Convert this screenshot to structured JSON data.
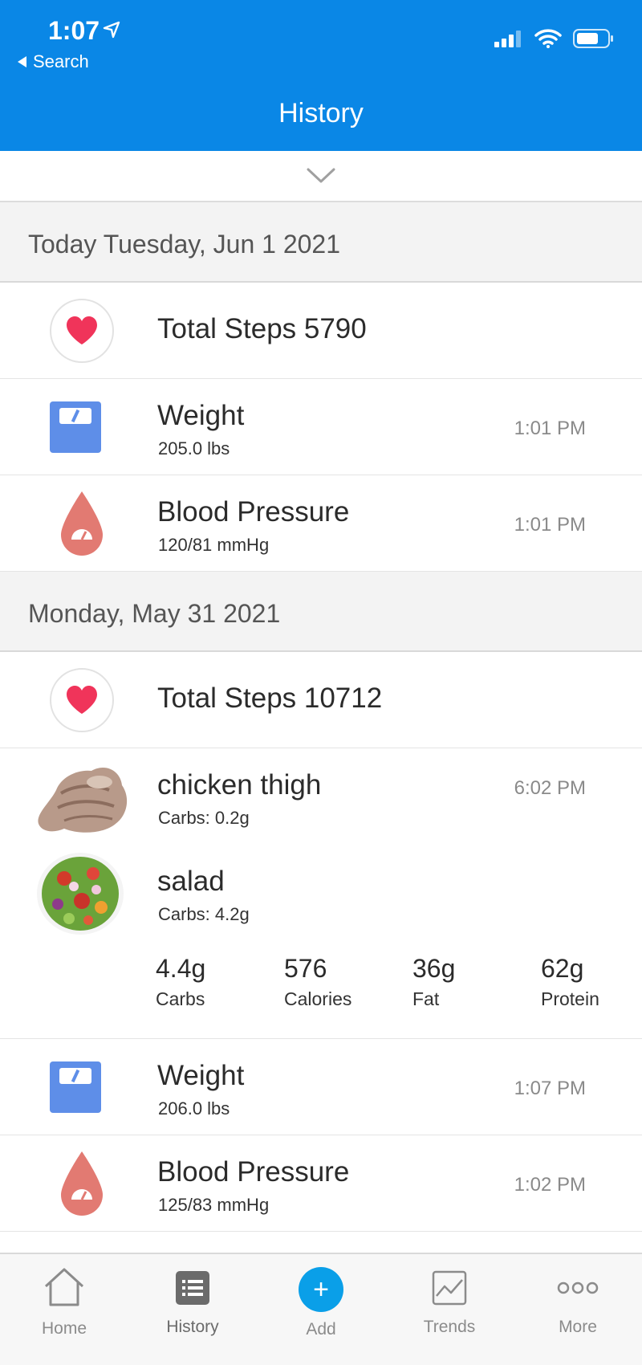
{
  "status_bar": {
    "time": "1:07",
    "back_label": "Search"
  },
  "header": {
    "title": "History"
  },
  "days": [
    {
      "date": "Today Tuesday, Jun 1 2021",
      "steps": "Total Steps 5790",
      "weight": {
        "label": "Weight",
        "value": "205.0 lbs",
        "time": "1:01 PM"
      },
      "bp": {
        "label": "Blood Pressure",
        "value": "120/81 mmHg",
        "time": "1:01 PM"
      }
    },
    {
      "date": "Monday, May 31 2021",
      "steps": "Total Steps 10712",
      "meal": {
        "time": "6:02 PM",
        "items": [
          {
            "name": "chicken thigh",
            "carbs": "Carbs: 0.2g"
          },
          {
            "name": "salad",
            "carbs": "Carbs: 4.2g"
          }
        ],
        "totals": [
          {
            "value": "4.4g",
            "label": "Carbs"
          },
          {
            "value": "576",
            "label": "Calories"
          },
          {
            "value": "36g",
            "label": "Fat"
          },
          {
            "value": "62g",
            "label": "Protein"
          }
        ]
      },
      "weight": {
        "label": "Weight",
        "value": "206.0 lbs",
        "time": "1:07 PM"
      },
      "bp": {
        "label": "Blood Pressure",
        "value": "125/83 mmHg",
        "time": "1:02 PM"
      }
    }
  ],
  "tabs": [
    {
      "label": "Home",
      "icon": "home-icon"
    },
    {
      "label": "History",
      "icon": "history-icon"
    },
    {
      "label": "Add",
      "icon": "plus-icon"
    },
    {
      "label": "Trends",
      "icon": "trends-icon"
    },
    {
      "label": "More",
      "icon": "more-icon"
    }
  ],
  "colors": {
    "header": "#0a87e6",
    "heart": "#f0345a",
    "scale": "#5e8ee8",
    "drop": "#e27a72",
    "add": "#0a9fe8"
  }
}
